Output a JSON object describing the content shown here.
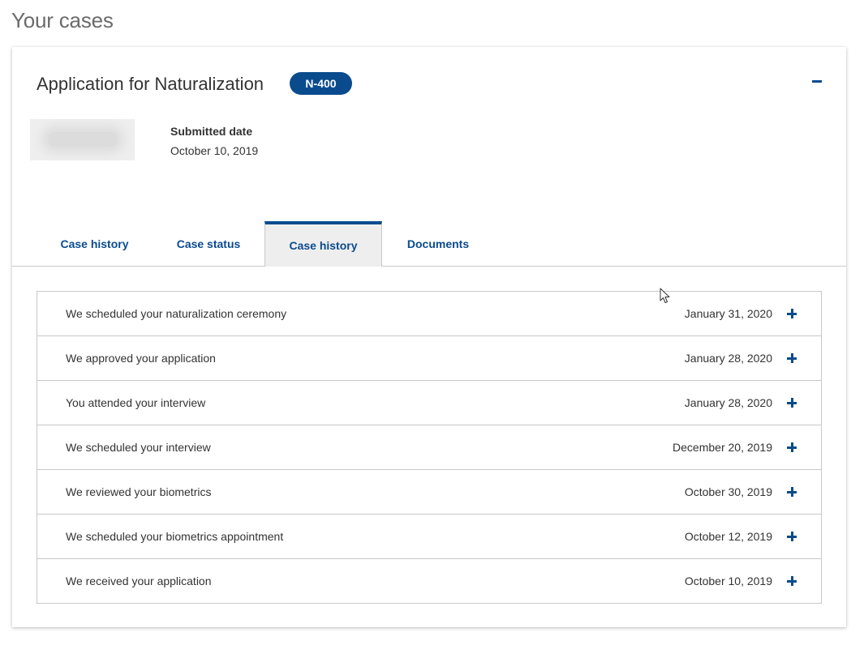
{
  "page": {
    "heading": "Your cases"
  },
  "case": {
    "title": "Application for Naturalization",
    "form_badge": "N-400",
    "collapse_icon": "minus-icon",
    "submitted_label": "Submitted date",
    "submitted_date": "October 10, 2019"
  },
  "tabs": [
    {
      "label": "Case history",
      "active": false
    },
    {
      "label": "Case status",
      "active": false
    },
    {
      "label": "Case history",
      "active": true
    },
    {
      "label": "Documents",
      "active": false
    }
  ],
  "history": [
    {
      "event": "We scheduled your naturalization ceremony",
      "date": "January 31, 2020"
    },
    {
      "event": "We approved your application",
      "date": "January 28, 2020"
    },
    {
      "event": "You attended your interview",
      "date": "January 28, 2020"
    },
    {
      "event": "We scheduled your interview",
      "date": "December 20, 2019"
    },
    {
      "event": "We reviewed your biometrics",
      "date": "October 30, 2019"
    },
    {
      "event": "We scheduled your biometrics appointment",
      "date": "October 12, 2019"
    },
    {
      "event": "We received your application",
      "date": "October 10, 2019"
    }
  ],
  "icons": {
    "expand": "plus-icon",
    "pointer": "mouse-cursor-icon"
  },
  "colors": {
    "accent": "#0a4b8e",
    "active_tab_bg": "#eeeeee",
    "border": "#c8c8c8",
    "heading": "#6b6b6b"
  }
}
